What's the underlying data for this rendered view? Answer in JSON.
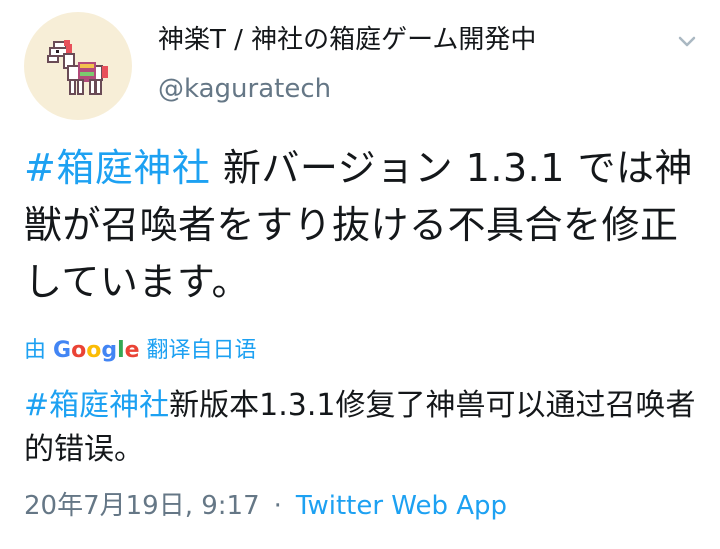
{
  "author": {
    "display_name": "神楽T / 神社の箱庭ゲーム開発中",
    "handle": "@kaguratech",
    "avatar_icon": "pixel-horse-icon"
  },
  "tweet": {
    "hashtag": "#箱庭神社",
    "text_rest": " 新バージョン 1.3.1 では神獣が召喚者をすり抜ける不具合を修正しています。"
  },
  "translation": {
    "by_label": "由",
    "provider_G": "G",
    "provider_o1": "o",
    "provider_o2": "o",
    "provider_g": "g",
    "provider_l": "l",
    "provider_e": "e",
    "action_label": "翻译自日语",
    "hashtag": "#箱庭神社",
    "text_rest": "新版本1.3.1修复了神兽可以通过召唤者的错误。"
  },
  "meta": {
    "timestamp": "20年7月19日, 9:17",
    "separator": "·",
    "source": "Twitter Web App"
  },
  "colors": {
    "link": "#1da1f2",
    "secondary_text": "#657786",
    "primary_text": "#14171a",
    "avatar_bg": "#f7eed7"
  }
}
